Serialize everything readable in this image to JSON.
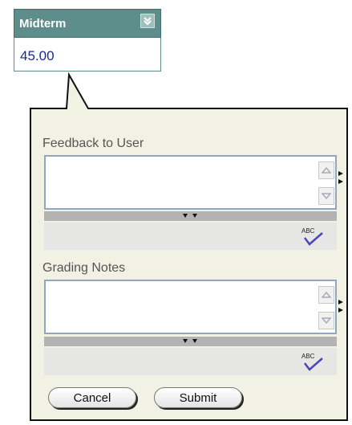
{
  "column": {
    "title": "Midterm",
    "menu_icon": "chevron-down-icon"
  },
  "grade": {
    "value": "45.00"
  },
  "editor": {
    "feedback_label": "Feedback to User",
    "notes_label": "Grading Notes",
    "feedback_text": "",
    "notes_text": ""
  },
  "buttons": {
    "cancel": "Cancel",
    "submit": "Submit"
  },
  "colors": {
    "header": "#5d8e8c",
    "popup_bg": "#f1f1e4",
    "field_border": "#8fa6c4",
    "value_text": "#1a2a88"
  }
}
